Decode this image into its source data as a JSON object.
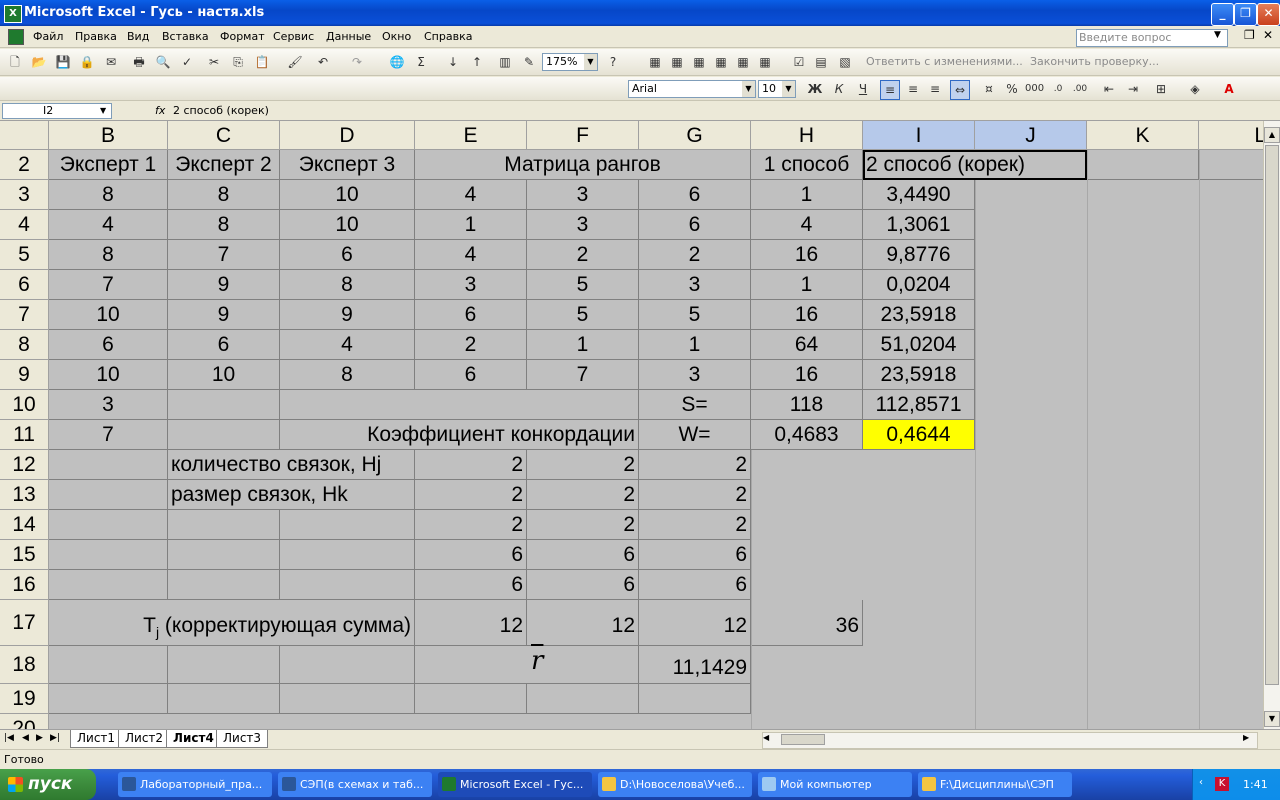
{
  "window": {
    "title": "Microsoft Excel - Гусь - настя.xls",
    "min": "_",
    "max": "❐",
    "close": "✕"
  },
  "menu": [
    "Файл",
    "Правка",
    "Вид",
    "Вставка",
    "Формат",
    "Сервис",
    "Данные",
    "Окно",
    "Справка"
  ],
  "help_placeholder": "Введите вопрос",
  "toolbar": {
    "zoom": "175%",
    "reply_label": "Ответить с изменениями...",
    "end_review_label": "Закончить проверку...",
    "font": "Arial",
    "font_size": "10",
    "bold": "Ж",
    "italic": "К",
    "underline": "Ч",
    "percent": "%",
    "thousands": "000"
  },
  "formula_bar": {
    "cell_ref": "I2",
    "fx": "fx",
    "formula": "2 способ (корек)"
  },
  "columns": [
    "B",
    "C",
    "D",
    "E",
    "F",
    "G",
    "H",
    "I",
    "J",
    "K",
    "L"
  ],
  "rows": [
    "2",
    "3",
    "4",
    "5",
    "6",
    "7",
    "8",
    "9",
    "10",
    "11",
    "12",
    "13",
    "14",
    "15",
    "16",
    "17",
    "18",
    "19",
    "20"
  ],
  "cells": {
    "B2": "Эксперт 1",
    "C2": "Эксперт 2",
    "D2": "Эксперт 3",
    "E2": "Матрица рангов",
    "H2": "1 способ",
    "I2": "2 способ (корек)",
    "B3": "8",
    "C3": "8",
    "D3": "10",
    "E3": "4",
    "F3": "3",
    "G3": "6",
    "H3": "1",
    "I3": "3,4490",
    "B4": "4",
    "C4": "8",
    "D4": "10",
    "E4": "1",
    "F4": "3",
    "G4": "6",
    "H4": "4",
    "I4": "1,3061",
    "B5": "8",
    "C5": "7",
    "D5": "6",
    "E5": "4",
    "F5": "2",
    "G5": "2",
    "H5": "16",
    "I5": "9,8776",
    "B6": "7",
    "C6": "9",
    "D6": "8",
    "E6": "3",
    "F6": "5",
    "G6": "3",
    "H6": "1",
    "I6": "0,0204",
    "B7": "10",
    "C7": "9",
    "D7": "9",
    "E7": "6",
    "F7": "5",
    "G7": "5",
    "H7": "16",
    "I7": "23,5918",
    "B8": "6",
    "C8": "6",
    "D8": "4",
    "E8": "2",
    "F8": "1",
    "G8": "1",
    "H8": "64",
    "I8": "51,0204",
    "B9": "10",
    "C9": "10",
    "D9": "8",
    "E9": "6",
    "F9": "7",
    "G9": "3",
    "H9": "16",
    "I9": "23,5918",
    "B10": "3",
    "G10": "S=",
    "H10": "118",
    "I10": "112,8571",
    "B11": "7",
    "F11": "Коэффициент конкордации",
    "G11": "W=",
    "H11": "0,4683",
    "I11": "0,4644",
    "C12": "количество связок, Hj",
    "E12": "2",
    "F12": "2",
    "G12": "2",
    "C13": "размер связок, Hk",
    "E13": "2",
    "F13": "2",
    "G13": "2",
    "E14": "2",
    "F14": "2",
    "G14": "2",
    "E15": "6",
    "F15": "6",
    "G15": "6",
    "E16": "6",
    "F16": "6",
    "G16": "6",
    "D17_T": "T",
    "D17_sub": "j",
    "D17": " (корректирующая сумма)",
    "E17": "12",
    "F17": "12",
    "G17": "12",
    "H17": "36",
    "F18": "r",
    "G18": "11,1429"
  },
  "sheets": [
    "Лист1",
    "Лист2",
    "Лист4",
    "Лист3"
  ],
  "active_sheet": "Лист4",
  "status": "Готово",
  "taskbar": {
    "start": "пуск",
    "tasks": [
      "Лабораторный_пра...",
      "СЭП(в схемах и таб...",
      "Microsoft Excel - Гус...",
      "D:\\Новоселова\\Учеб...",
      "Мой компьютер",
      "F:\\Дисциплины\\СЭП"
    ],
    "clock": "1:41"
  },
  "colors": {
    "highlight": "#ffff00",
    "grid_bg": "#c0c0c0",
    "selected_header": "#b6c9ea"
  }
}
